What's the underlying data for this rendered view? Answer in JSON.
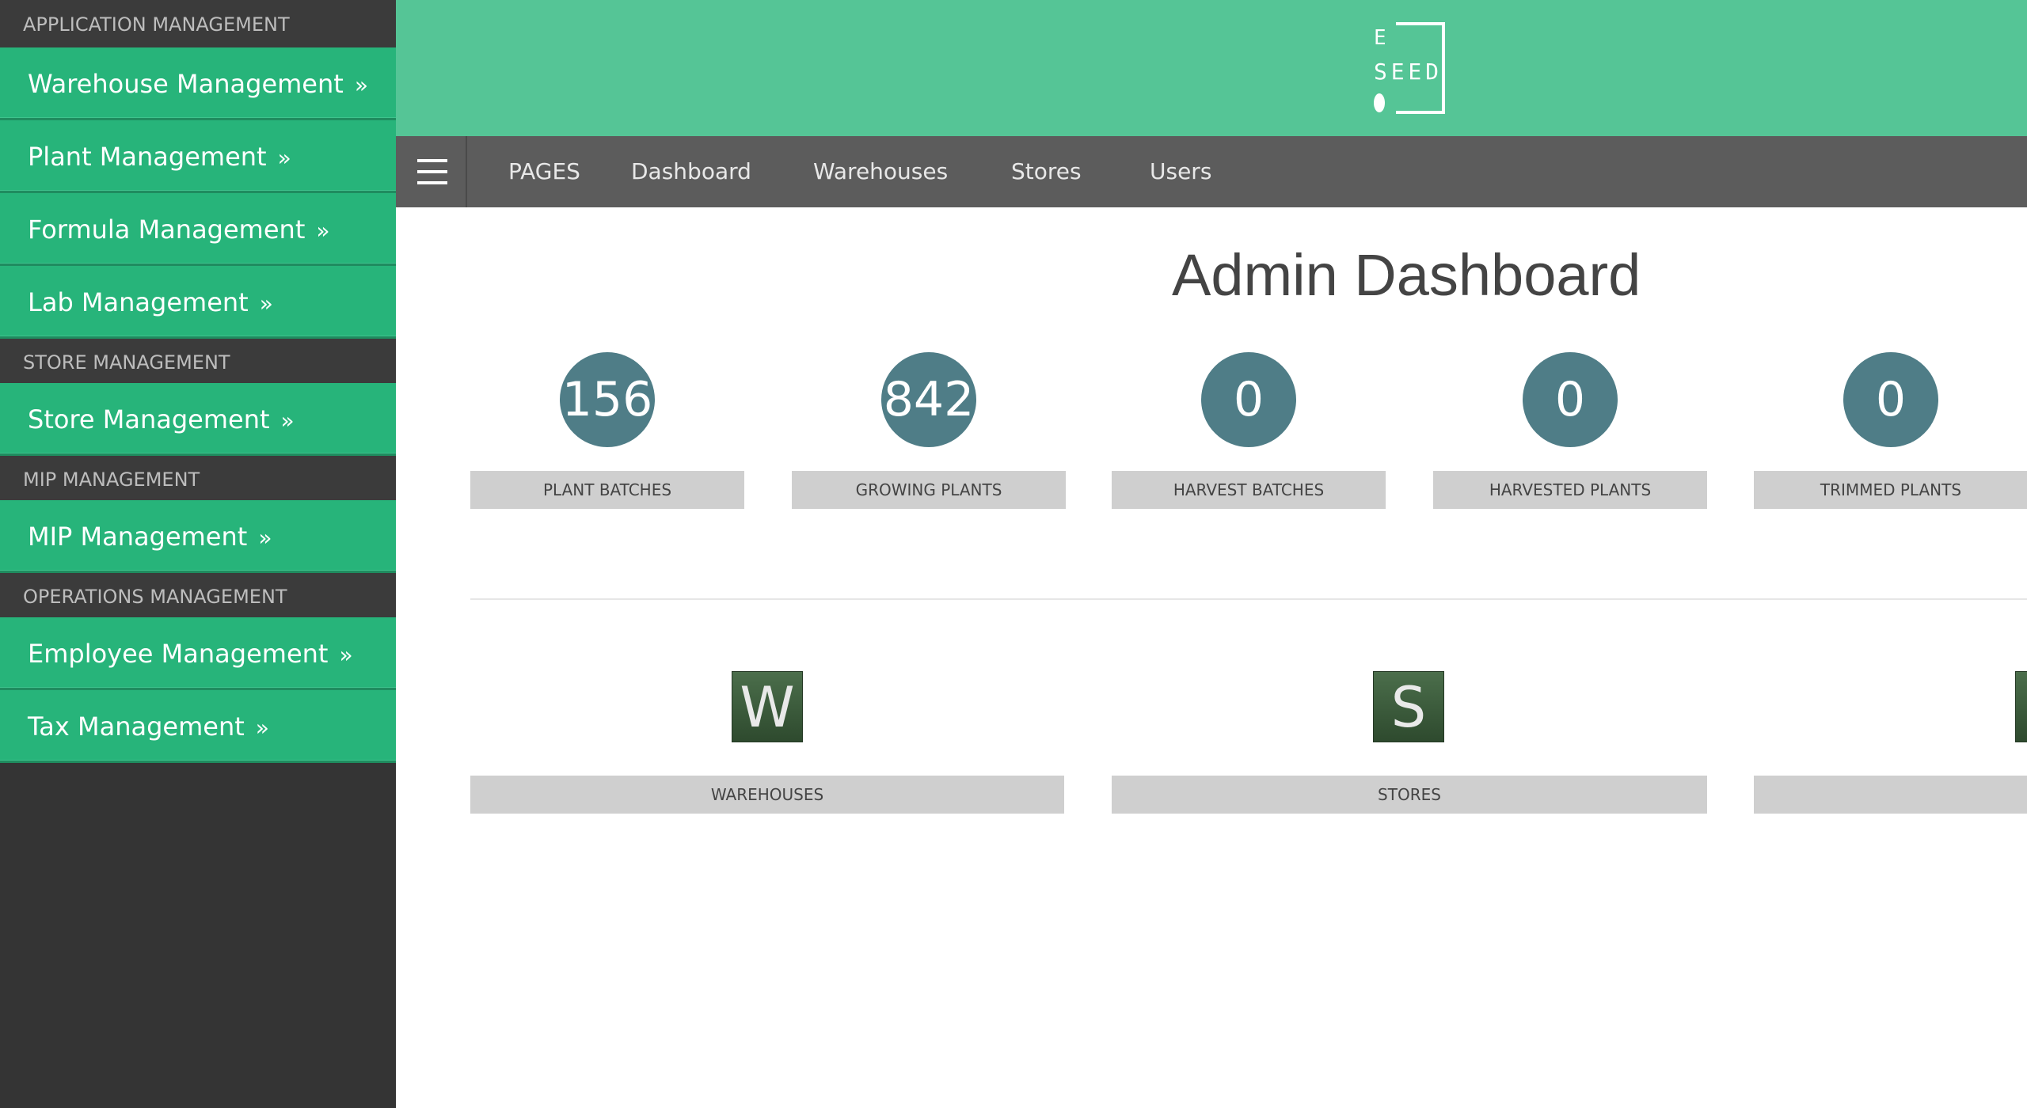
{
  "sidebar": {
    "sections": [
      {
        "header": "APPLICATION MANAGEMENT",
        "items": [
          "Warehouse Management",
          "Plant Management",
          "Formula Management",
          "Lab Management"
        ]
      },
      {
        "header": "STORE MANAGEMENT",
        "items": [
          "Store Management"
        ]
      },
      {
        "header": "MIP MANAGEMENT",
        "items": [
          "MIP Management"
        ]
      },
      {
        "header": "OPERATIONS MANAGEMENT",
        "items": [
          "Employee Management",
          "Tax Management"
        ]
      }
    ],
    "chevron": "»"
  },
  "header": {
    "logo_letters": [
      "E",
      "SEED"
    ],
    "logo_icon": "seed-icon"
  },
  "navbar": {
    "menu_icon": "hamburger-menu-icon",
    "links": [
      "PAGES",
      "Dashboard",
      "Warehouses",
      "Stores",
      "Users"
    ]
  },
  "main": {
    "title": "Admin Dashboard",
    "stats": [
      {
        "value": "156",
        "label": "PLANT BATCHES"
      },
      {
        "value": "842",
        "label": "GROWING PLANTS"
      },
      {
        "value": "0",
        "label": "HARVEST BATCHES"
      },
      {
        "value": "0",
        "label": "HARVESTED PLANTS"
      },
      {
        "value": "0",
        "label": "TRIMMED PLANTS"
      }
    ],
    "tiles": [
      {
        "letter": "W",
        "label": "WAREHOUSES"
      },
      {
        "letter": "S",
        "label": "STORES"
      },
      {
        "letter": "",
        "label": ""
      }
    ]
  },
  "colors": {
    "sidebar_bg": "#343434",
    "nav_item": "#27b47a",
    "header_bg": "#55c596",
    "navbar_bg": "#5c5c5c",
    "stat_circle": "#4f7d87",
    "label_bg": "#cfcfcf",
    "tile_bg": "#3b5a3b"
  }
}
